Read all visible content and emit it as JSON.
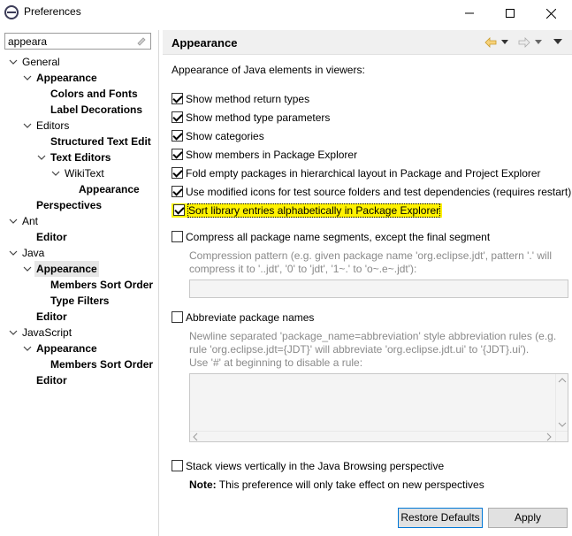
{
  "window": {
    "title": "Preferences"
  },
  "filter": {
    "value": "appeara"
  },
  "tree": [
    {
      "label": "General",
      "indent": 0,
      "arrow": "v",
      "bold": false
    },
    {
      "label": "Appearance",
      "indent": 1,
      "arrow": "v",
      "bold": true
    },
    {
      "label": "Colors and Fonts",
      "indent": 2,
      "arrow": "",
      "bold": true
    },
    {
      "label": "Label Decorations",
      "indent": 2,
      "arrow": "",
      "bold": true
    },
    {
      "label": "Editors",
      "indent": 1,
      "arrow": "v",
      "bold": false
    },
    {
      "label": "Structured Text Edit",
      "indent": 2,
      "arrow": "",
      "bold": true
    },
    {
      "label": "Text Editors",
      "indent": 2,
      "arrow": "v",
      "bold": true
    },
    {
      "label": "WikiText",
      "indent": 3,
      "arrow": "v",
      "bold": false
    },
    {
      "label": "Appearance",
      "indent": 4,
      "arrow": "",
      "bold": true
    },
    {
      "label": "Perspectives",
      "indent": 1,
      "arrow": "",
      "bold": true
    },
    {
      "label": "Ant",
      "indent": 0,
      "arrow": "v",
      "bold": false
    },
    {
      "label": "Editor",
      "indent": 1,
      "arrow": "",
      "bold": true
    },
    {
      "label": "Java",
      "indent": 0,
      "arrow": "v",
      "bold": false
    },
    {
      "label": "Appearance",
      "indent": 1,
      "arrow": "v",
      "bold": true,
      "selected": true
    },
    {
      "label": "Members Sort Order",
      "indent": 2,
      "arrow": "",
      "bold": true
    },
    {
      "label": "Type Filters",
      "indent": 2,
      "arrow": "",
      "bold": true
    },
    {
      "label": "Editor",
      "indent": 1,
      "arrow": "",
      "bold": true
    },
    {
      "label": "JavaScript",
      "indent": 0,
      "arrow": "v",
      "bold": false
    },
    {
      "label": "Appearance",
      "indent": 1,
      "arrow": "v",
      "bold": true
    },
    {
      "label": "Members Sort Order",
      "indent": 2,
      "arrow": "",
      "bold": true
    },
    {
      "label": "Editor",
      "indent": 1,
      "arrow": "",
      "bold": true
    }
  ],
  "page": {
    "title": "Appearance",
    "description": "Appearance of Java elements in viewers:",
    "options": [
      {
        "label": "Show method return types",
        "checked": true
      },
      {
        "label": "Show method type parameters",
        "checked": true
      },
      {
        "label": "Show categories",
        "checked": true
      },
      {
        "label": "Show members in Package Explorer",
        "checked": true
      },
      {
        "label": "Fold empty packages in hierarchical layout in Package and Project Explorer",
        "checked": true
      },
      {
        "label": "Use modified icons for test source folders and test dependencies (requires restart)",
        "checked": true
      },
      {
        "label": "Sort library entries alphabetically in Package Explorer",
        "checked": true,
        "highlight": true
      }
    ],
    "compress": {
      "label": "Compress all package name segments, except the final segment",
      "checked": false,
      "hint1": "Compression pattern (e.g. given package name 'org.eclipse.jdt', pattern '.' will",
      "hint2": "compress it to '..jdt', '0' to 'jdt', '1~.' to 'o~.e~.jdt'):",
      "value": ""
    },
    "abbreviate": {
      "label": "Abbreviate package names",
      "checked": false,
      "hint1": "Newline separated 'package_name=abbreviation' style abbreviation rules (e.g.",
      "hint2": "rule 'org.eclipse.jdt={JDT}' will abbreviate 'org.eclipse.jdt.ui' to '{JDT}.ui').",
      "hint3": "Use '#' at beginning to disable a rule:",
      "value": ""
    },
    "stack": {
      "label": "Stack views vertically in the Java Browsing perspective",
      "checked": false
    },
    "note_label": "Note:",
    "note_text": "This preference will only take effect on new perspectives"
  },
  "buttons": {
    "restore": "Restore Defaults",
    "apply": "Apply"
  }
}
